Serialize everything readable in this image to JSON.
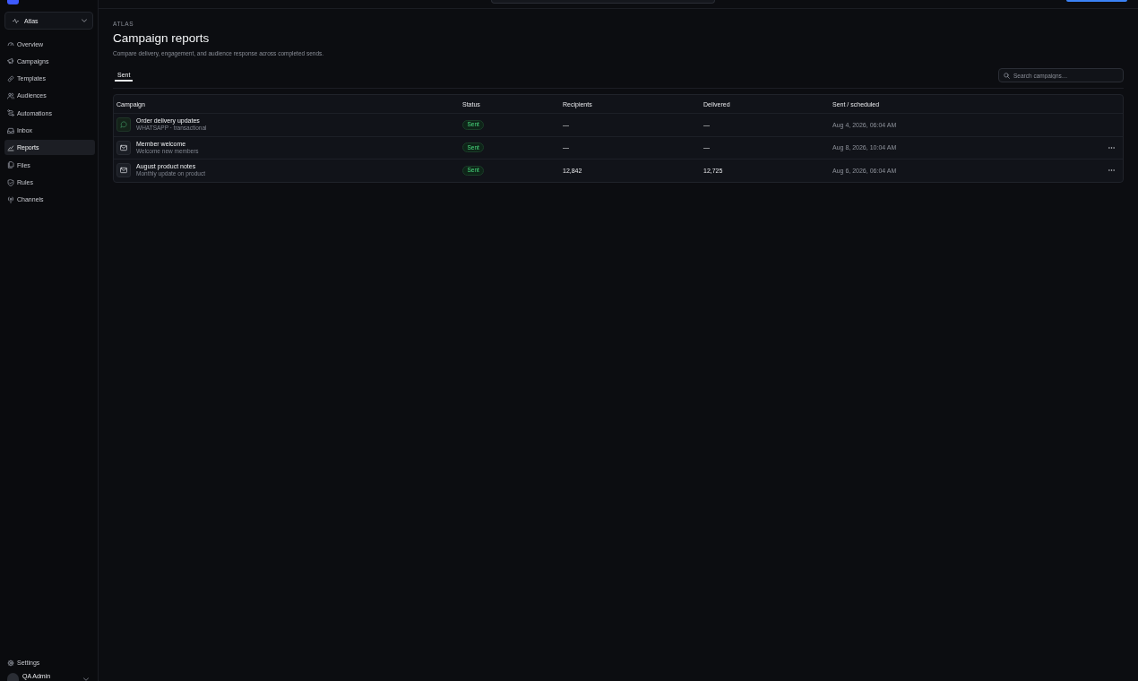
{
  "workspace": {
    "name": "Atlas"
  },
  "sidebar": {
    "items": [
      {
        "label": "Overview",
        "selected": false
      },
      {
        "label": "Campaigns",
        "selected": false
      },
      {
        "label": "Templates",
        "selected": false
      },
      {
        "label": "Audiences",
        "selected": false
      },
      {
        "label": "Automations",
        "selected": false
      },
      {
        "label": "Inbox",
        "selected": false
      },
      {
        "label": "Reports",
        "selected": true
      },
      {
        "label": "Files",
        "selected": false
      },
      {
        "label": "Rules",
        "selected": false
      },
      {
        "label": "Channels",
        "selected": false
      }
    ],
    "footer_items": [
      {
        "label": "Settings",
        "selected": false
      }
    ]
  },
  "user": {
    "name": "QA Admin"
  },
  "page": {
    "eyebrow": "ATLAS",
    "title": "Campaign reports",
    "subtitle": "Compare delivery, engagement, and audience response across completed sends."
  },
  "tabs": [
    {
      "label": "Sent",
      "selected": true
    }
  ],
  "search": {
    "placeholder": "Search campaigns…"
  },
  "table": {
    "columns": [
      "Campaign",
      "Status",
      "Recipients",
      "Delivered",
      "Sent / scheduled"
    ],
    "rows": [
      {
        "kind": "whatsapp",
        "name": "Order delivery updates",
        "description": "WHATSAPP · transactional",
        "status": "Sent",
        "recipients": "—",
        "delivered": "—",
        "sent_at": "Aug 4, 2026, 06:04 AM",
        "has_menu": false
      },
      {
        "kind": "email",
        "name": "Member welcome",
        "description": "Welcome new members",
        "status": "Sent",
        "recipients": "—",
        "delivered": "—",
        "sent_at": "Aug 8, 2026, 10:04 AM",
        "has_menu": true
      },
      {
        "kind": "email",
        "name": "August product notes",
        "description": "Monthly update on product",
        "status": "Sent",
        "recipients": "12,842",
        "delivered": "12,725",
        "sent_at": "Aug 6, 2026, 06:04 AM",
        "has_menu": true
      }
    ]
  }
}
